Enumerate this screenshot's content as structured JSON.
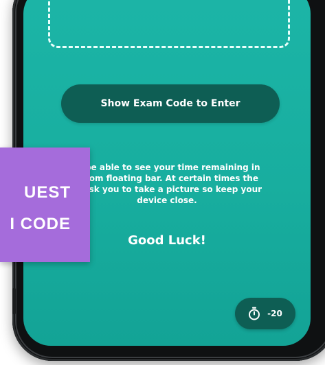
{
  "screen": {
    "exam_button_label": "Show Exam Code to Enter",
    "info_lines": [
      "ill be able to see your time remaining in",
      "ottom floating bar. At certain times the",
      "ill ask you to take a picture so keep your",
      "device close."
    ],
    "good_luck": "Good Luck!",
    "timer": {
      "icon": "stopwatch-icon",
      "value": "-20"
    }
  },
  "overlay": {
    "lines": [
      "UEST",
      "I CODE"
    ]
  },
  "colors": {
    "screen_teal": "#18ae9f",
    "button_dark_green": "#0e5e54",
    "overlay_purple": "#a56cdb"
  }
}
